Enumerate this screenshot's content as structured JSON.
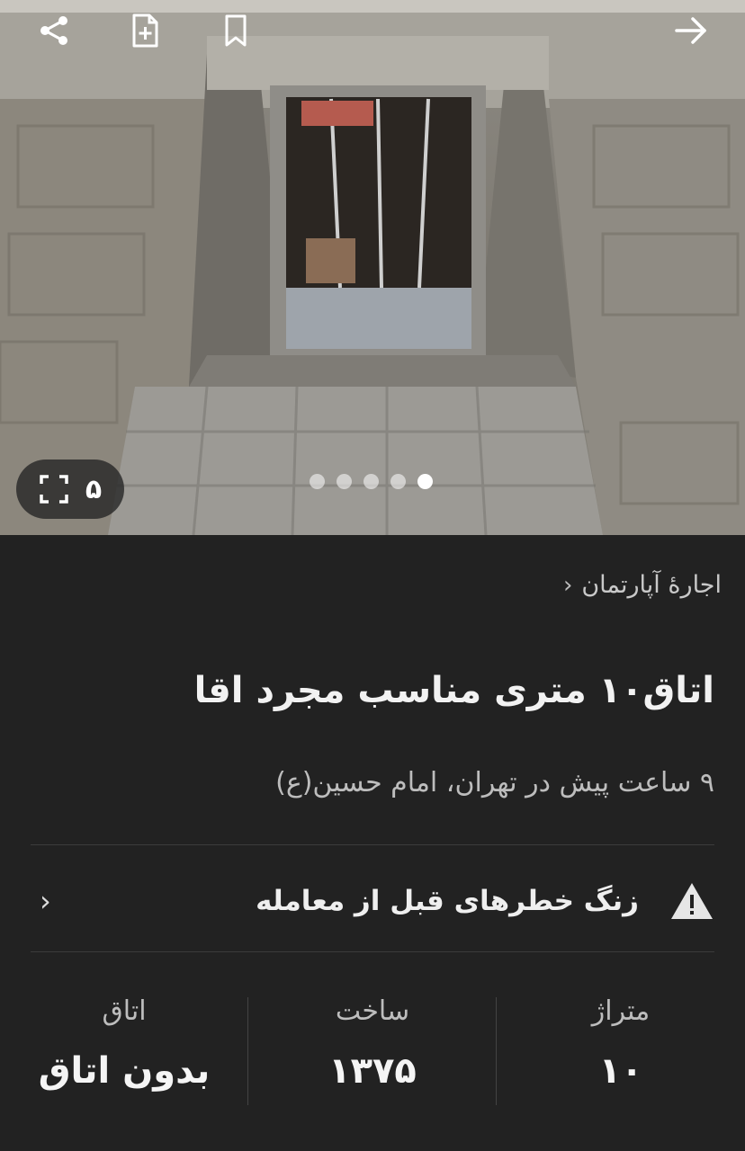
{
  "gallery": {
    "photo_count": "۵",
    "total_slides": 5,
    "active_slide": 5
  },
  "toolbar": {
    "icons": [
      "share-icon",
      "add-note-icon",
      "bookmark-icon",
      "back-arrow-icon"
    ]
  },
  "breadcrumb": {
    "label": "اجارهٔ آپارتمان"
  },
  "listing": {
    "title": "اتاق۱۰ متری مناسب مجرد اقا",
    "meta": "۹ ساعت پیش در تهران، امام حسین(ع)"
  },
  "warning": {
    "label": "زنگ خطرهای قبل از معامله"
  },
  "stats": [
    {
      "label": "متراژ",
      "value": "۱۰"
    },
    {
      "label": "ساخت",
      "value": "۱۳۷۵"
    },
    {
      "label": "اتاق",
      "value": "بدون اتاق"
    }
  ],
  "colors": {
    "background": "#222222",
    "text_primary": "#f2f2f2",
    "text_secondary": "#bdbdbd",
    "divider": "#3c3c3c"
  }
}
